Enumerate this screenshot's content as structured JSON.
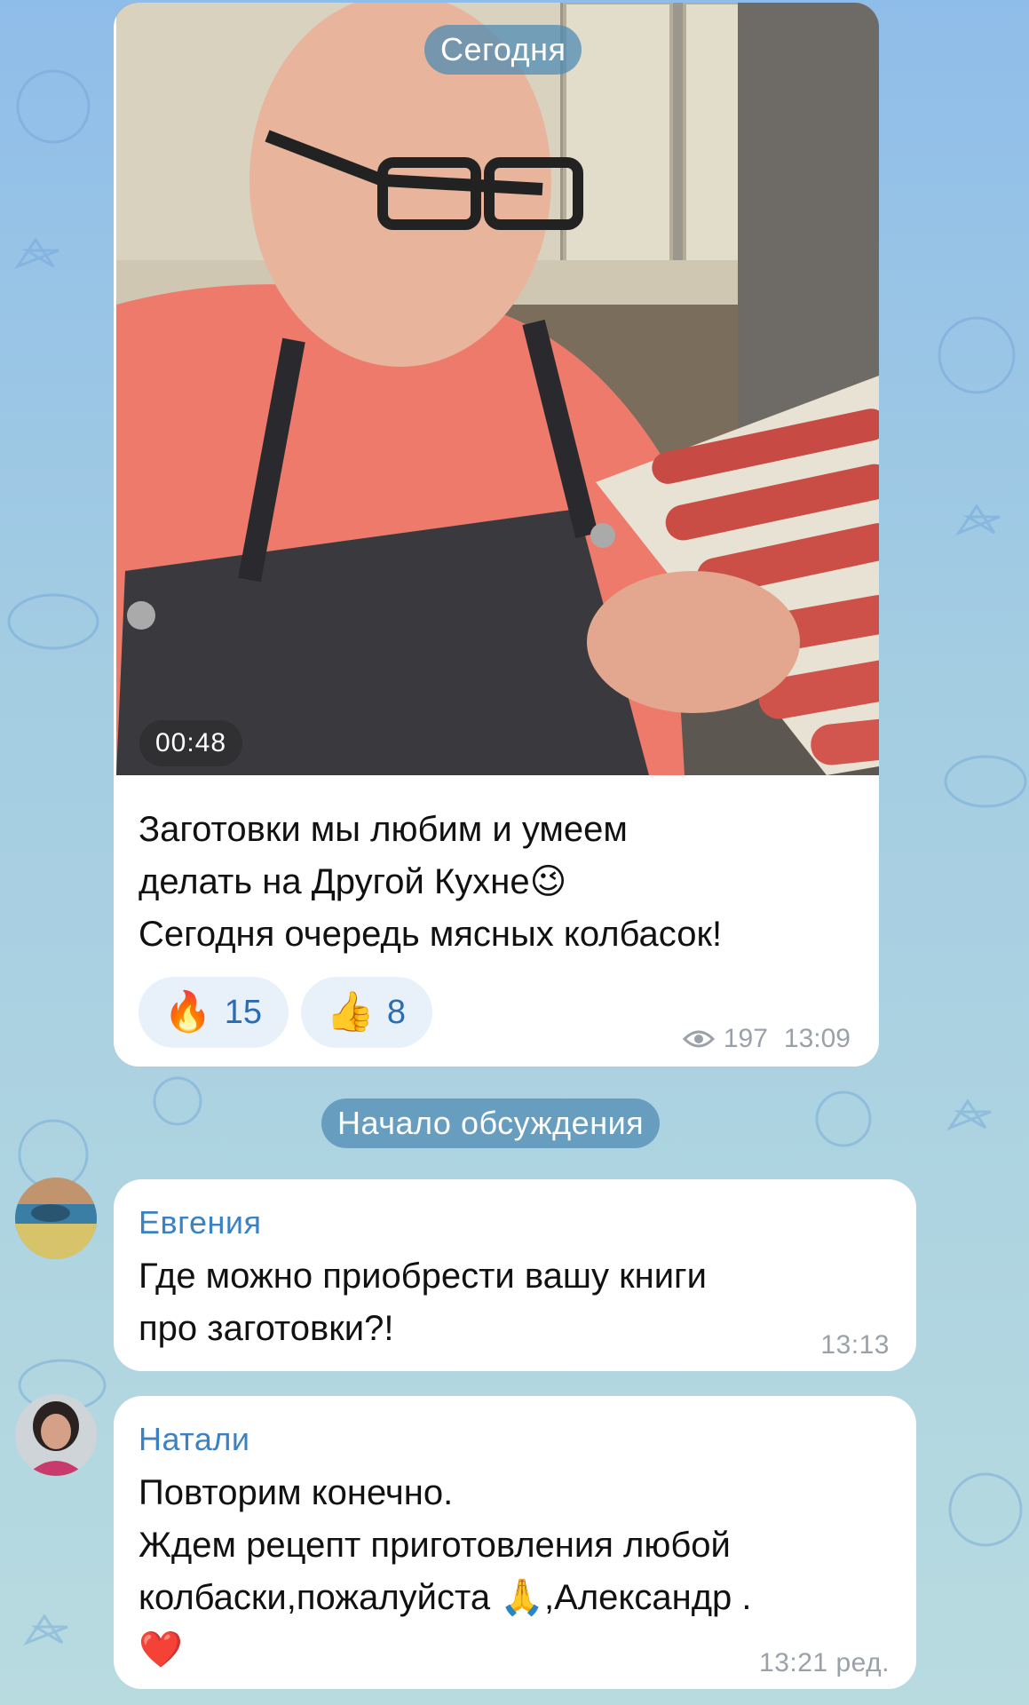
{
  "date_pill": "Сегодня",
  "post": {
    "video_duration": "00:48",
    "text": "Заготовки мы любим и умеем\nделать на Другой Кухне😉\nСегодня очередь мясных колбасок!",
    "reactions": [
      {
        "emoji": "🔥",
        "count": "15"
      },
      {
        "emoji": "👍",
        "count": "8"
      }
    ],
    "views": "197",
    "time": "13:09"
  },
  "discussion_pill": "Начало обсуждения",
  "comments": [
    {
      "author": "Евгения",
      "text": "Где можно приобрести вашу книги\nпро заготовки?!",
      "time": "13:13"
    },
    {
      "author": "Натали",
      "text": "Повторим конечно.\nЖдем рецепт приготовления  любой\nколбаски,пожалуйста 🙏,Александр .\n❤️",
      "time": "13:21 ред."
    }
  ],
  "colors": {
    "accent": "#3a82c4",
    "bubble": "#ffffff",
    "meta": "#9aa1a8"
  }
}
